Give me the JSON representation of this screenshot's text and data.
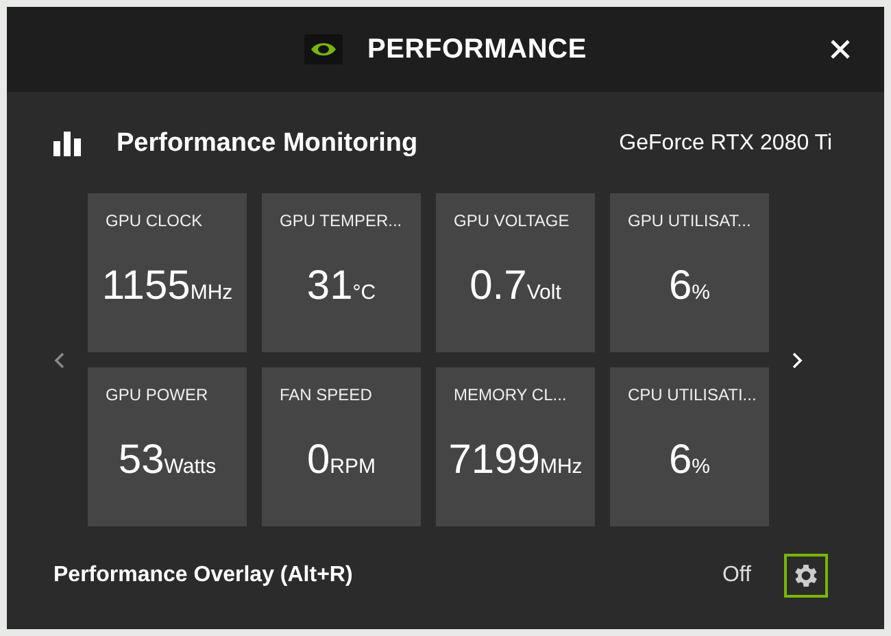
{
  "window": {
    "title": "PERFORMANCE"
  },
  "section": {
    "title": "Performance Monitoring",
    "gpu": "GeForce RTX 2080 Ti"
  },
  "metrics": [
    {
      "label": "GPU CLOCK",
      "value": "1155",
      "unit": "MHz"
    },
    {
      "label": "GPU TEMPER...",
      "value": "31",
      "unit": "°C"
    },
    {
      "label": "GPU VOLTAGE",
      "value": "0.7",
      "unit": "Volt"
    },
    {
      "label": "GPU UTILISAT...",
      "value": "6",
      "unit": "%"
    },
    {
      "label": "GPU POWER",
      "value": "53",
      "unit": "Watts"
    },
    {
      "label": "FAN SPEED",
      "value": "0",
      "unit": "RPM"
    },
    {
      "label": "MEMORY CL...",
      "value": "7199",
      "unit": "MHz"
    },
    {
      "label": "CPU UTILISATI...",
      "value": "6",
      "unit": "%"
    }
  ],
  "overlay": {
    "label": "Performance Overlay (Alt+R)",
    "status": "Off"
  }
}
